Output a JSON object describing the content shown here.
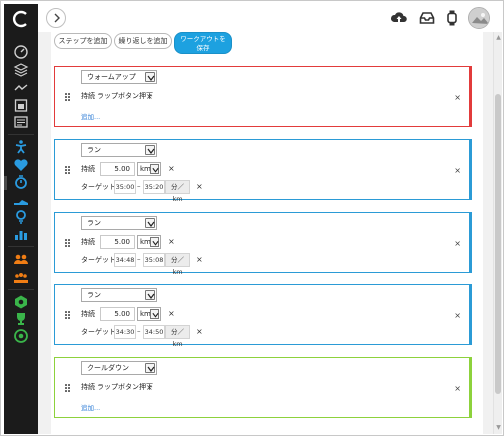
{
  "toolbar": {
    "add_step": "ステップを追加",
    "add_repeat": "繰り返しを追加",
    "save_line1": "ワークアウトを",
    "save_line2": "保存"
  },
  "steps": [
    {
      "type": "ウォームアップ",
      "duration_label": "持続",
      "duration_value": "ラップボタン押下",
      "add_link": "追加..."
    },
    {
      "type": "ラン",
      "duration_label": "持続",
      "distance": "5.00",
      "unit": "km",
      "target_label": "ターゲット:",
      "pace_from": "35:00",
      "pace_to": "35:20",
      "pace_unit": "分／km"
    },
    {
      "type": "ラン",
      "duration_label": "持続",
      "distance": "5.00",
      "unit": "km",
      "target_label": "ターゲット:",
      "pace_from": "34:48",
      "pace_to": "35:08",
      "pace_unit": "分／km"
    },
    {
      "type": "ラン",
      "duration_label": "持続",
      "distance": "5.00",
      "unit": "km",
      "target_label": "ターゲット:",
      "pace_from": "34:30",
      "pace_to": "34:50",
      "pace_unit": "分／km"
    },
    {
      "type": "クールダウン",
      "duration_label": "持続",
      "duration_value": "ラップボタン押下",
      "add_link": "追加..."
    }
  ],
  "colors": {
    "warmup": "#e23b3b",
    "run": "#2b9bd6",
    "cooldown": "#8dd23c",
    "accent": "#1da1e0",
    "sidebar": "#1b1b1b",
    "sidebar_activity_icons": "#2a9be0",
    "sidebar_social_icons": "#f07d14",
    "sidebar_challenge_icons": "#3ab54a"
  },
  "icons": {
    "sidebar": [
      "logo-icon",
      "dashboard-icon",
      "layers-icon",
      "trend-icon",
      "calendar-icon",
      "report-icon",
      "run-person-icon",
      "heart-icon",
      "stopwatch-icon",
      "shoe-icon",
      "lightbulb-icon",
      "bar-chart-icon",
      "connections-icon",
      "groups-icon",
      "badge-icon",
      "trophy-icon",
      "target-icon"
    ],
    "topbar": [
      "back-arrow-icon",
      "cloud-upload-icon",
      "inbox-icon",
      "watch-icon",
      "avatar"
    ]
  }
}
